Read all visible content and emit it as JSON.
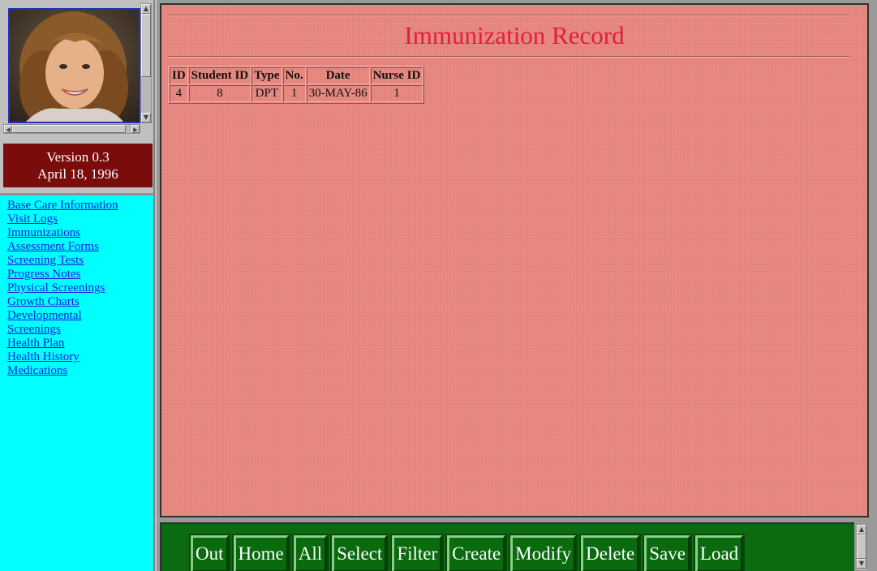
{
  "sidebar": {
    "photo_alt": "Student photo",
    "version": {
      "line1": "Version 0.3",
      "line2": "April 18, 1996"
    },
    "links": [
      "Base Care Information",
      "Visit Logs",
      "Immunizations",
      "Assessment Forms",
      "Screening Tests",
      "Progress Notes",
      "Physical Screenings",
      "Growth Charts",
      "Developmental",
      "Screenings",
      "Health Plan",
      "Health History",
      "Medications"
    ]
  },
  "main": {
    "title": "Immunization Record",
    "table": {
      "headers": [
        "ID",
        "Student ID",
        "Type",
        "No.",
        "Date",
        "Nurse ID"
      ],
      "rows": [
        [
          "4",
          "8",
          "DPT",
          "1",
          "30-MAY-86",
          "1"
        ]
      ]
    }
  },
  "toolbar": {
    "buttons": [
      "Out",
      "Home",
      "All",
      "Select",
      "Filter",
      "Create",
      "Modify",
      "Delete",
      "Save",
      "Load"
    ]
  },
  "colors": {
    "main_bg": "#e88880",
    "title": "#e0203a",
    "version_bg": "#7a0c0c",
    "nav_bg": "#00ffff",
    "link": "#1a1ae0",
    "toolbar_bg": "#0c6a10"
  },
  "icons": {
    "scroll_up": "scroll-up-arrow-icon",
    "scroll_down": "scroll-down-arrow-icon",
    "scroll_left": "scroll-left-arrow-icon",
    "scroll_right": "scroll-right-arrow-icon"
  }
}
